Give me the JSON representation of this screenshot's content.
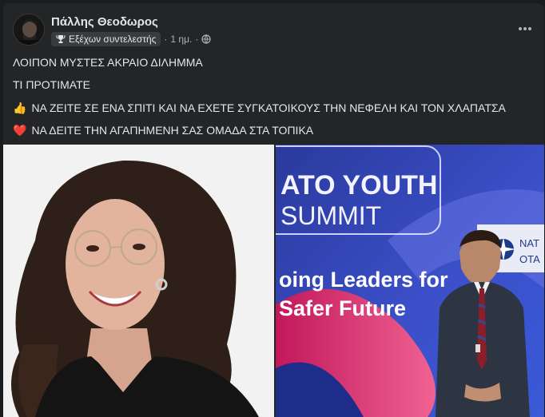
{
  "post": {
    "author": "Πάλλης Θεοδωρος",
    "badge_label": "Εξέχων συντελεστής",
    "time": "1 ημ.",
    "separator": "·",
    "lines": {
      "l1": "ΛΟΙΠΟΝ ΜΥΣΤΕΣ ΑΚΡΑΙΟ ΔΙΛΗΜΜΑ",
      "l2": "ΤΙ ΠΡΟΤΙΜΑΤΕ",
      "l3": "ΝΑ ΖΕΙΤΕ ΣΕ ΕΝΑ ΣΠΙΤΙ ΚΑΙ ΝΑ ΕΧΕΤΕ ΣΥΓΚΑΤΟΙΚΟΥΣ ΤΗΝ ΝΕΦΕΛΗ ΚΑΙ ΤΟΝ ΧΛΑΠΑΤΣΑ",
      "l4": "ΝΑ ΔΕΙΤΕ ΤΗΝ ΑΓΑΠΗΜΕΝΗ ΣΑΣ ΟΜΑΔΑ ΣΤΑ ΤΟΠΙΚΑ"
    },
    "emoji": {
      "l3": "👍",
      "l4": "❤️"
    },
    "icons": {
      "badge": "trophy-icon",
      "audience": "globe-icon",
      "menu": "more-options-icon"
    }
  },
  "photo_right": {
    "banner_line1": "ATO YOUTH",
    "banner_line2": "SUMMIT",
    "tag_line1": "oing Leaders for",
    "tag_line2": "Safer Future",
    "logo_text1": "NAT",
    "logo_text2": "OTA"
  },
  "colors": {
    "background": "#242526",
    "text": "#e4e6eb",
    "secondary_text": "#b0b3b8",
    "banner_blue": "#2a3b8c",
    "banner_magenta": "#d6266e"
  }
}
